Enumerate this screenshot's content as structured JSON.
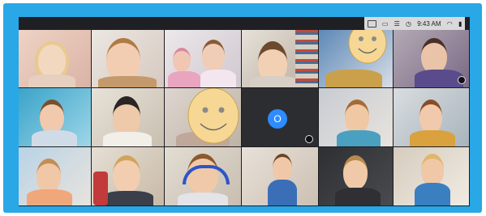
{
  "status_bar": {
    "time": "9:43 AM",
    "icons": [
      "video-camera-icon",
      "chat-icon",
      "menu-icon",
      "clock-icon",
      "wifi-icon",
      "battery-icon"
    ]
  },
  "tiles": [
    {
      "id": 1
    },
    {
      "id": 2
    },
    {
      "id": 3
    },
    {
      "id": 4
    },
    {
      "id": 5
    },
    {
      "id": 6
    },
    {
      "id": 7
    },
    {
      "id": 8
    },
    {
      "id": 9
    },
    {
      "id": 10,
      "avatar_letter": "O"
    },
    {
      "id": 11
    },
    {
      "id": 12
    },
    {
      "id": 13
    },
    {
      "id": 14
    },
    {
      "id": 15
    },
    {
      "id": 16
    },
    {
      "id": 17
    },
    {
      "id": 18
    }
  ],
  "overlays": {
    "smiley_faces": 2
  },
  "colors": {
    "border": "#29a7e6",
    "screen_bg": "#2a2c31",
    "smiley_face": "#f7d794",
    "avatar_blue": "#2d8cff"
  }
}
